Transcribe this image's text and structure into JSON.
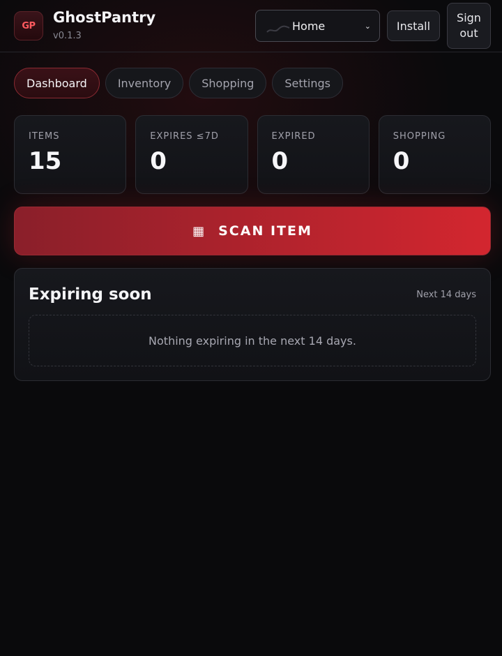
{
  "app": {
    "logo_text": "GP",
    "title": "GhostPantry",
    "version": "v0.1.3"
  },
  "header": {
    "home_select": {
      "selected": "Home"
    },
    "install_label": "Install",
    "signout_label": "Sign out"
  },
  "tabs": [
    {
      "label": "Dashboard",
      "active": true
    },
    {
      "label": "Inventory",
      "active": false
    },
    {
      "label": "Shopping",
      "active": false
    },
    {
      "label": "Settings",
      "active": false
    }
  ],
  "stats": [
    {
      "label": "ITEMS",
      "value": "15"
    },
    {
      "label": "EXPIRES ≤7D",
      "value": "0"
    },
    {
      "label": "EXPIRED",
      "value": "0"
    },
    {
      "label": "SHOPPING",
      "value": "0"
    }
  ],
  "scan": {
    "icon": "barcode-icon",
    "icon_glyph": "▦",
    "label": "SCAN ITEM"
  },
  "expiring": {
    "title": "Expiring soon",
    "range": "Next 14 days",
    "empty_message": "Nothing expiring in the next 14 days."
  },
  "colors": {
    "accent": "#d3262f",
    "accent_dark": "#8a1f2a",
    "background": "#0a0a0c",
    "logo_text": "#ff5a5f"
  }
}
